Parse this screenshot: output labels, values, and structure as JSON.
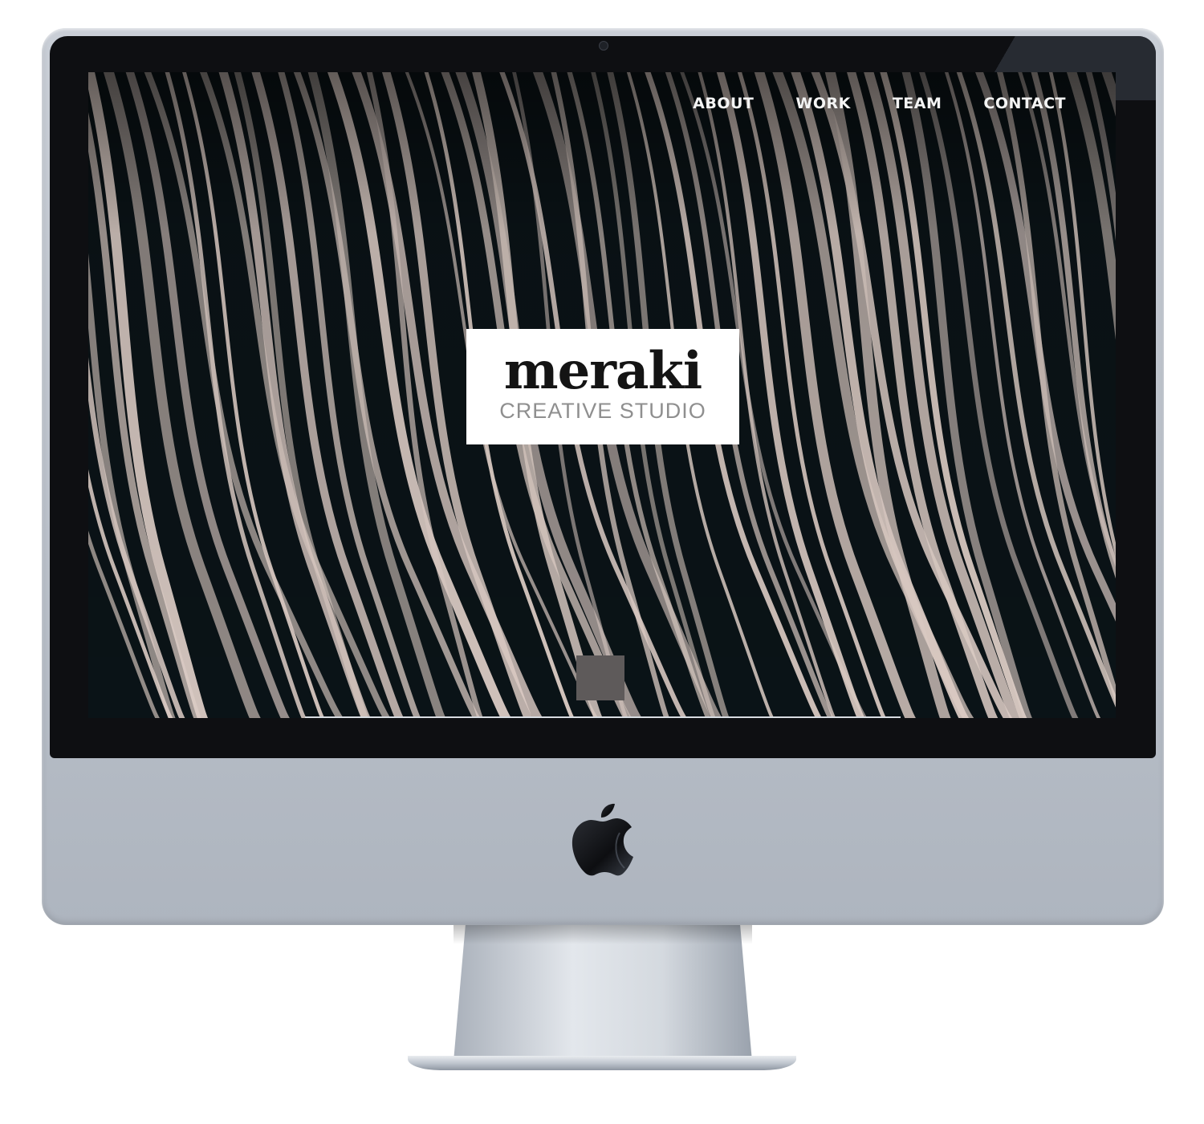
{
  "nav": {
    "items": [
      {
        "label": "ABOUT"
      },
      {
        "label": "WORK"
      },
      {
        "label": "TEAM"
      },
      {
        "label": "CONTACT"
      }
    ]
  },
  "logo": {
    "wordmark": "meraki",
    "tagline": "CREATIVE STUDIO"
  },
  "device": {
    "brand_icon": "apple-logo-icon"
  },
  "colors": {
    "hero_background": "#0b1418",
    "stripe": "#e9d8d0",
    "nav_text": "#f4f4f4",
    "logo_box": "#ffffff",
    "scroll_button": "#5e5a5a"
  }
}
